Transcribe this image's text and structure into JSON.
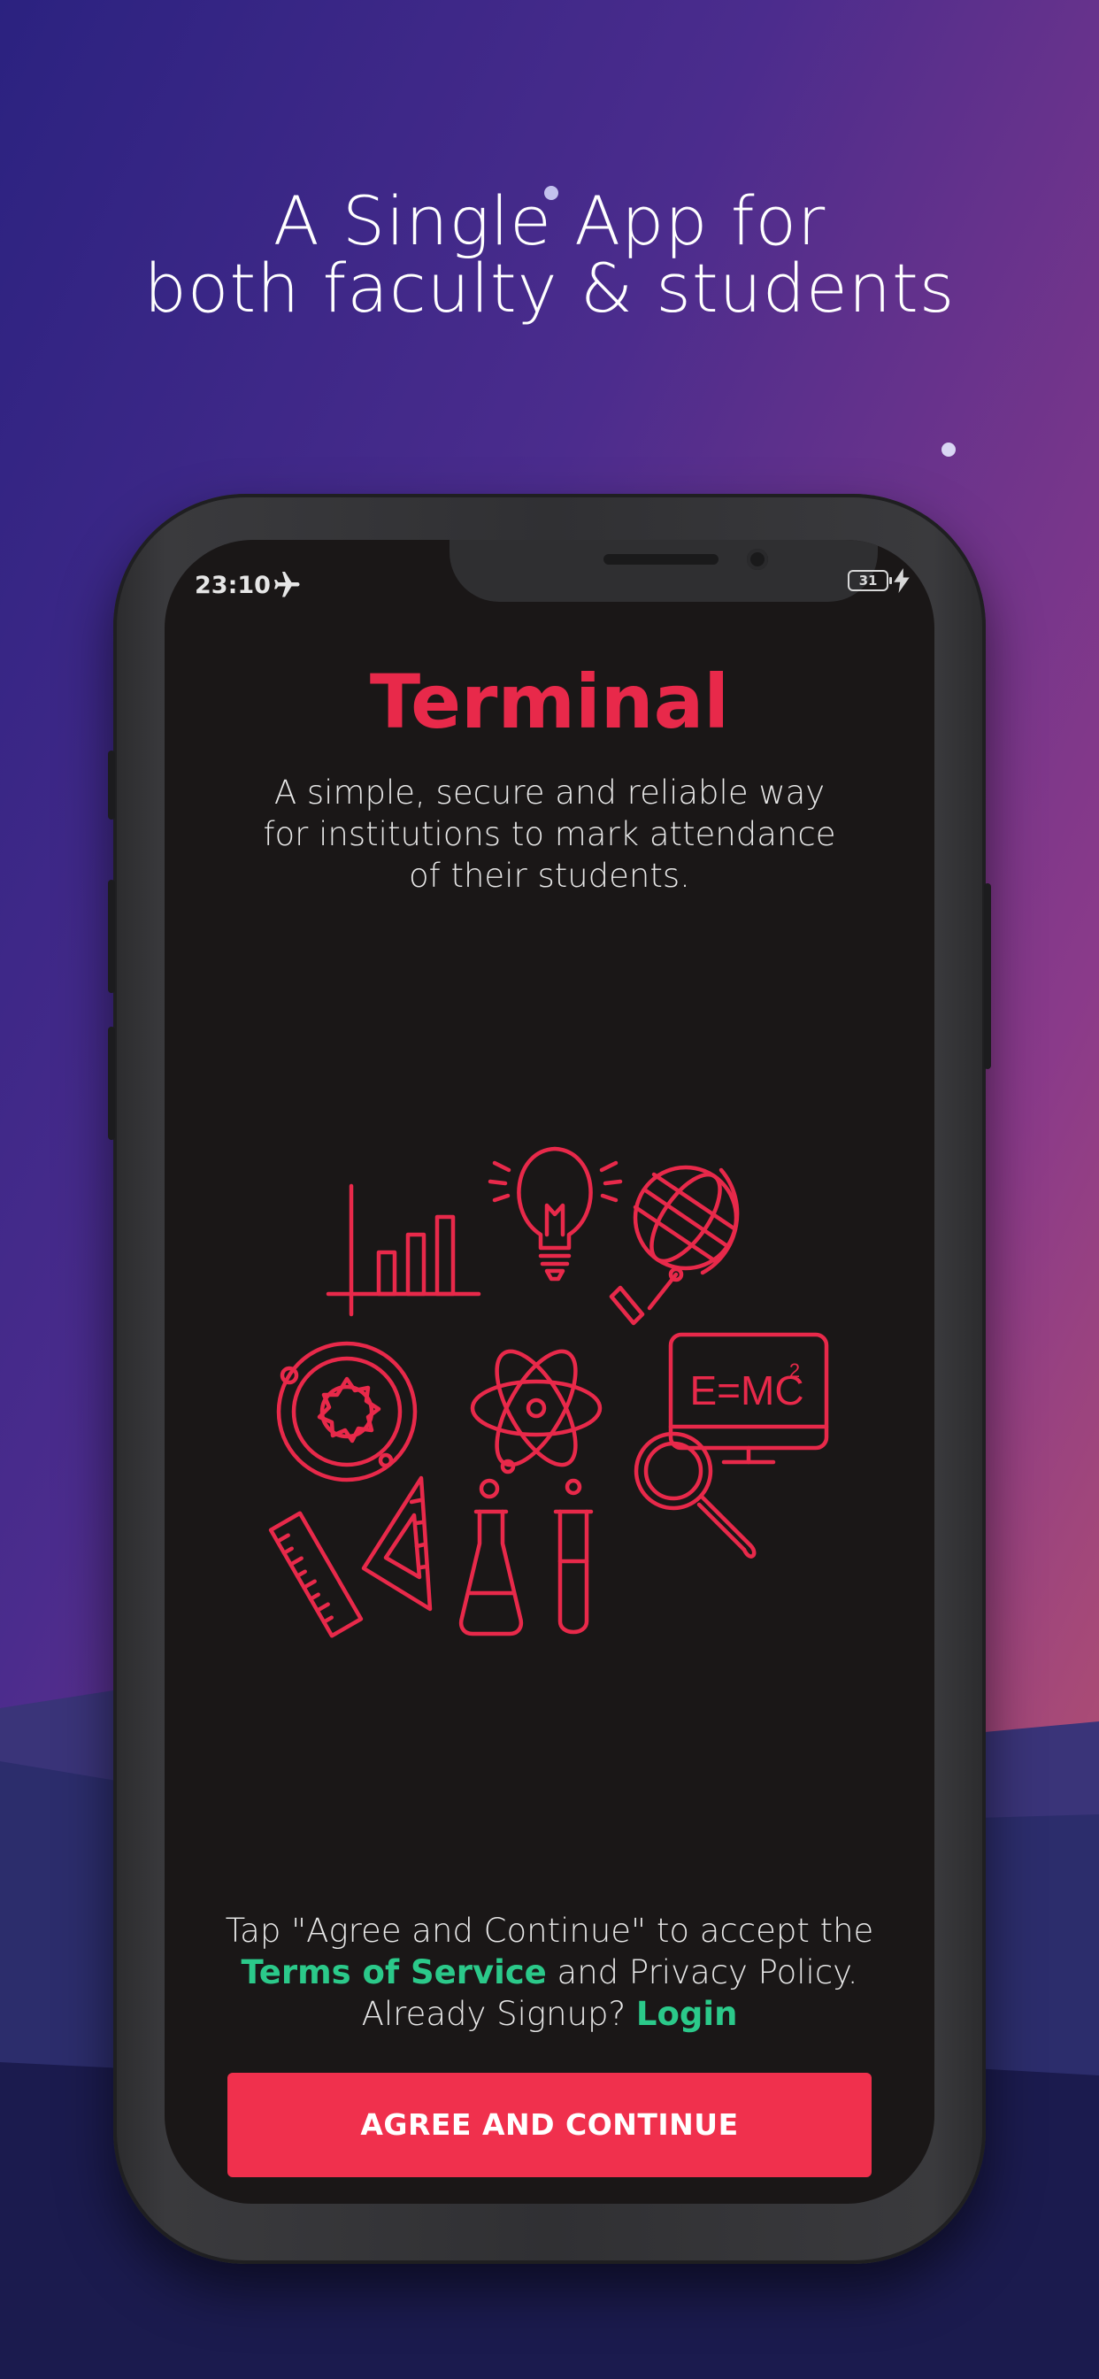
{
  "promo": {
    "headline_line1": "A Single App for",
    "headline_line2": "both faculty & students"
  },
  "status_bar": {
    "time": "23:10",
    "airplane_icon": "airplane-icon",
    "battery_level": "31",
    "charging_icon": "lightning-bolt-icon"
  },
  "app": {
    "title": "Terminal",
    "description": "A simple, secure and reliable way for institutions to mark attendance of their students.",
    "illustration_icons": [
      "bar-chart-icon",
      "lightbulb-icon",
      "globe-icon",
      "orbit-icon",
      "atom-icon",
      "computer-formula-icon",
      "ruler-icon",
      "set-square-icon",
      "flask-icon",
      "test-tube-icon",
      "magnifier-icon"
    ],
    "formula_text": "E=MC",
    "formula_exponent": "2"
  },
  "consent": {
    "line1": "Tap \"Agree and Continue\" to accept the",
    "terms_link": "Terms of Service",
    "line2_rest": " and Privacy Policy.",
    "already_prefix": "Already Signup? ",
    "login_link": "Login"
  },
  "actions": {
    "agree_button_label": "AGREE AND CONTINUE"
  },
  "colors": {
    "accent_red": "#f0304d",
    "title_red": "#e8294a",
    "link_green": "#2bc98a",
    "screen_bg": "#1a1717"
  }
}
